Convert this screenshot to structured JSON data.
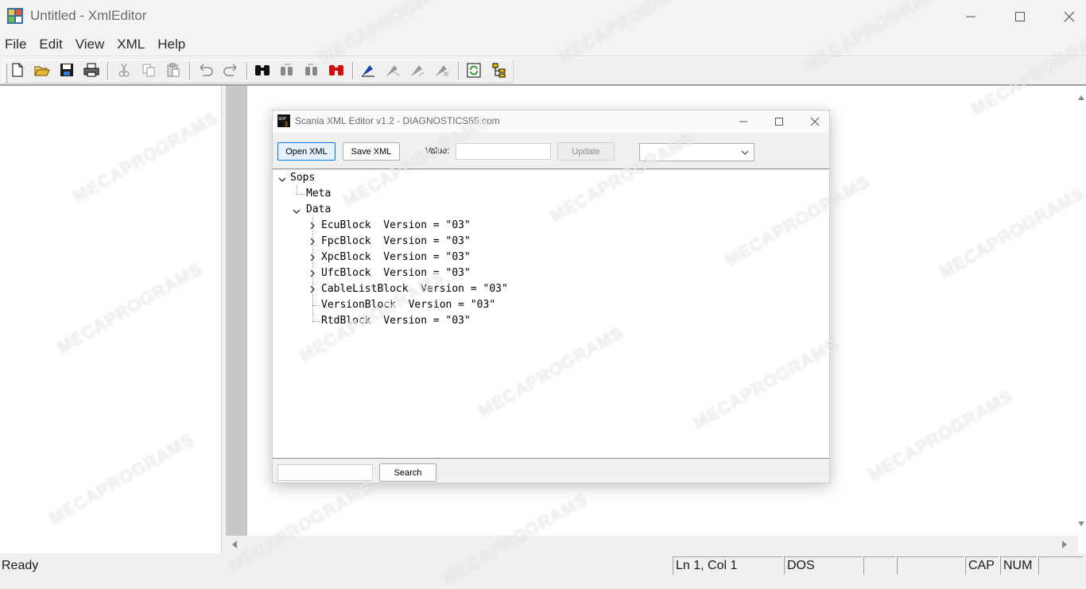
{
  "window": {
    "title": "Untitled - XmlEditor"
  },
  "menu": [
    "File",
    "Edit",
    "View",
    "XML",
    "Help"
  ],
  "toolbar": {
    "icons": [
      "new-file-icon",
      "open-folder-icon",
      "save-icon",
      "print-icon",
      "cut-icon",
      "copy-icon",
      "paste-icon",
      "undo-icon",
      "redo-icon",
      "find-icon",
      "find-next-icon",
      "find-previous-icon",
      "replace-icon",
      "tag-icon",
      "tag-next-icon",
      "tag-previous-icon",
      "tag-clear-icon",
      "refresh-icon",
      "tree-view-icon"
    ]
  },
  "dialog": {
    "title": "Scania XML Editor v1.2 - DIAGNOSTICS55.com",
    "open_label": "Open XML",
    "save_label": "Save XML",
    "value_label": "Value:",
    "value_input": "",
    "update_label": "Update",
    "dropdown_value": "",
    "search_input": "",
    "search_label": "Search",
    "tree": [
      {
        "label": "Sops",
        "expanded": true
      },
      {
        "label": "Meta"
      },
      {
        "label": "Data",
        "expanded": true
      },
      {
        "label": "EcuBlock  Version = \"03\"",
        "collapsed": true
      },
      {
        "label": "FpcBlock  Version = \"03\"",
        "collapsed": true
      },
      {
        "label": "XpcBlock  Version = \"03\"",
        "collapsed": true
      },
      {
        "label": "UfcBlock  Version = \"03\"",
        "collapsed": true
      },
      {
        "label": "CableListBlock  Version = \"03\"",
        "collapsed": true
      },
      {
        "label": "VersionBlock  Version = \"03\""
      },
      {
        "label": "RtdBlock  Version = \"03\""
      }
    ]
  },
  "status": {
    "ready": "Ready",
    "position": "Ln 1, Col 1",
    "format": "DOS",
    "cap": "CAP",
    "num": "NUM"
  },
  "watermark": "MECAPROGRAMS"
}
